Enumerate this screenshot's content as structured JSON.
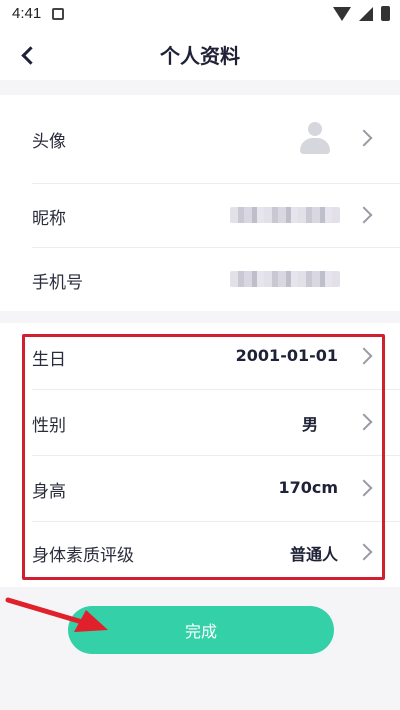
{
  "status_bar": {
    "time": "4:41"
  },
  "header": {
    "title": "个人资料"
  },
  "profile": {
    "avatar_label": "头像",
    "nickname_label": "昵称",
    "phone_label": "手机号"
  },
  "details": {
    "birthday_label": "生日",
    "birthday_value": "2001-01-01",
    "gender_label": "性别",
    "gender_value": "男",
    "height_label": "身高",
    "height_value": "170cm",
    "fitness_label": "身体素质评级",
    "fitness_value": "普通人"
  },
  "actions": {
    "done_label": "完成"
  },
  "colors": {
    "accent": "#34d0a8",
    "highlight": "#d02030",
    "text": "#1f2236"
  }
}
